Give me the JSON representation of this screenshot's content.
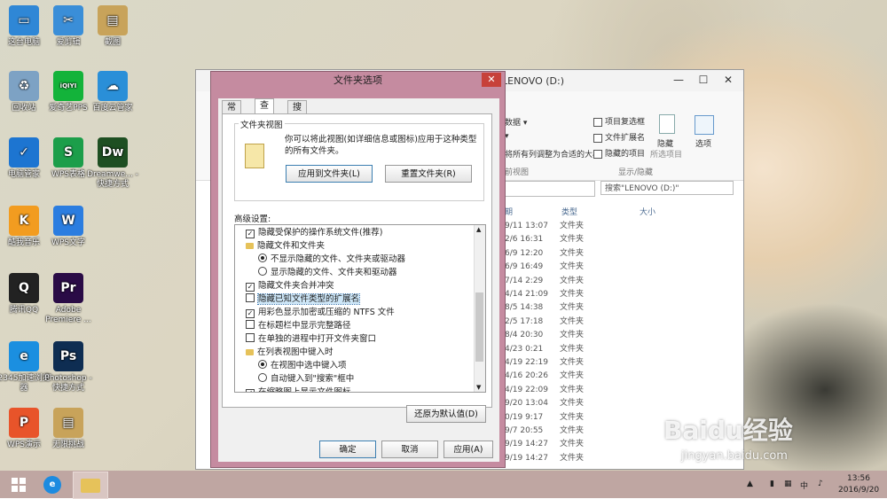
{
  "desktop": {
    "icons": [
      {
        "label": "这台电脑",
        "color": "#2f87d6"
      },
      {
        "label": "爱剪辑",
        "color": "#3a8ed8"
      },
      {
        "label": "截图",
        "color": "#c8a35a"
      },
      {
        "label": "回收站",
        "color": "#7da2c4"
      },
      {
        "label": "爱奇艺PPS",
        "color": "#13b33a"
      },
      {
        "label": "百度云管家",
        "color": "#2a8fd8"
      },
      {
        "label": "电脑管家",
        "color": "#1d75d1"
      },
      {
        "label": "WPS表格",
        "color": "#1c9e4a"
      },
      {
        "label": "Dreamwe... - 快捷方式",
        "color": "#1e4f22"
      },
      {
        "label": "酷我音乐",
        "color": "#f29c20"
      },
      {
        "label": "WPS文字",
        "color": "#2b7de0"
      },
      {
        "label": "腾讯QQ",
        "color": "#222222"
      },
      {
        "label": "Adobe Premiere ...",
        "color": "#2a0b46"
      },
      {
        "label": "2345加速浏览器",
        "color": "#1b8fe0"
      },
      {
        "label": "Photoshop - 快捷方式",
        "color": "#0e2d52"
      },
      {
        "label": "WPS演示",
        "color": "#e8542a"
      },
      {
        "label": "无限挑战",
        "color": "#c8a35a"
      }
    ],
    "glyphs": [
      "▭",
      "✂",
      "▤",
      "♻",
      "iQIYI",
      "☁",
      "✓",
      "S",
      "Dw",
      "K",
      "W",
      "Q",
      "Pr",
      "e",
      "Ps",
      "P",
      "▤"
    ]
  },
  "explorer": {
    "title": "LENOVO (D:)",
    "minimize": "—",
    "maximize": "☐",
    "close": "✕",
    "ribbon": {
      "data_label": "数据 ▾",
      "fit_label": "▾",
      "fit_cols_label": "将所有列调整为合适的大小",
      "view_label": "前视图",
      "item_checkbox": "项目复选框",
      "file_ext": "文件扩展名",
      "hidden_items": "隐藏的项目",
      "hide_label": "隐藏",
      "selected_items": "所选项目",
      "options_label": "选项",
      "show_hide": "显示/隐藏"
    },
    "search_placeholder": "搜索\"LENOVO (D:)\"",
    "columns": {
      "date": "期",
      "type": "类型",
      "size": "大小"
    },
    "rows": [
      {
        "date": "9/11 13:07",
        "type": "文件夹"
      },
      {
        "date": "2/6 16:31",
        "type": "文件夹"
      },
      {
        "date": "6/9 12:20",
        "type": "文件夹"
      },
      {
        "date": "6/9 16:49",
        "type": "文件夹"
      },
      {
        "date": "7/14 2:29",
        "type": "文件夹"
      },
      {
        "date": "4/14 21:09",
        "type": "文件夹"
      },
      {
        "date": "8/5 14:38",
        "type": "文件夹"
      },
      {
        "date": "2/5 17:18",
        "type": "文件夹"
      },
      {
        "date": "8/4 20:30",
        "type": "文件夹"
      },
      {
        "date": "4/23 0:21",
        "type": "文件夹"
      },
      {
        "date": "4/19 22:19",
        "type": "文件夹"
      },
      {
        "date": "4/16 20:26",
        "type": "文件夹"
      },
      {
        "date": "4/19 22:09",
        "type": "文件夹"
      },
      {
        "date": "9/20 13:04",
        "type": "文件夹"
      },
      {
        "date": "0/19 9:17",
        "type": "文件夹"
      },
      {
        "date": "9/7 20:55",
        "type": "文件夹"
      },
      {
        "date": "9/19 14:27",
        "type": "文件夹"
      },
      {
        "date": "9/19 14:27",
        "type": "文件夹"
      }
    ]
  },
  "dialog": {
    "title": "文件夹选项",
    "close": "✕",
    "tabs": [
      "常规",
      "查看",
      "搜索"
    ],
    "folder_view_group": "文件夹视图",
    "folder_view_desc": "你可以将此视图(如详细信息或图标)应用于这种类型的所有文件夹。",
    "apply_to_folders": "应用到文件夹(L)",
    "reset_folders": "重置文件夹(R)",
    "advanced_label": "高级设置:",
    "settings": [
      {
        "kind": "check",
        "checked": true,
        "label": "隐藏受保护的操作系统文件(推荐)"
      },
      {
        "kind": "folder",
        "label": "隐藏文件和文件夹"
      },
      {
        "kind": "radio",
        "checked": true,
        "label": "不显示隐藏的文件、文件夹或驱动器"
      },
      {
        "kind": "radio",
        "checked": false,
        "label": "显示隐藏的文件、文件夹和驱动器"
      },
      {
        "kind": "check",
        "checked": true,
        "label": "隐藏文件夹合并冲突"
      },
      {
        "kind": "check",
        "checked": false,
        "label": "隐藏已知文件类型的扩展名",
        "selected": true
      },
      {
        "kind": "check",
        "checked": true,
        "label": "用彩色显示加密或压缩的 NTFS 文件"
      },
      {
        "kind": "check",
        "checked": false,
        "label": "在标题栏中显示完整路径"
      },
      {
        "kind": "check",
        "checked": false,
        "label": "在单独的进程中打开文件夹窗口"
      },
      {
        "kind": "folder",
        "label": "在列表视图中键入时"
      },
      {
        "kind": "radio",
        "checked": true,
        "label": "在视图中选中键入项"
      },
      {
        "kind": "radio",
        "checked": false,
        "label": "自动键入到\"搜索\"框中"
      },
      {
        "kind": "check",
        "checked": true,
        "label": "在缩略图上显示文件图标"
      }
    ],
    "restore_defaults": "还原为默认值(D)",
    "ok": "确定",
    "cancel": "取消",
    "apply": "应用(A)"
  },
  "taskbar": {
    "start_icon": "windows-logo",
    "time": "13:56",
    "date": "2016/9/20",
    "ime": "中",
    "watermark": "Baidu经验",
    "watermark_url": "jingyan.baidu.com"
  }
}
